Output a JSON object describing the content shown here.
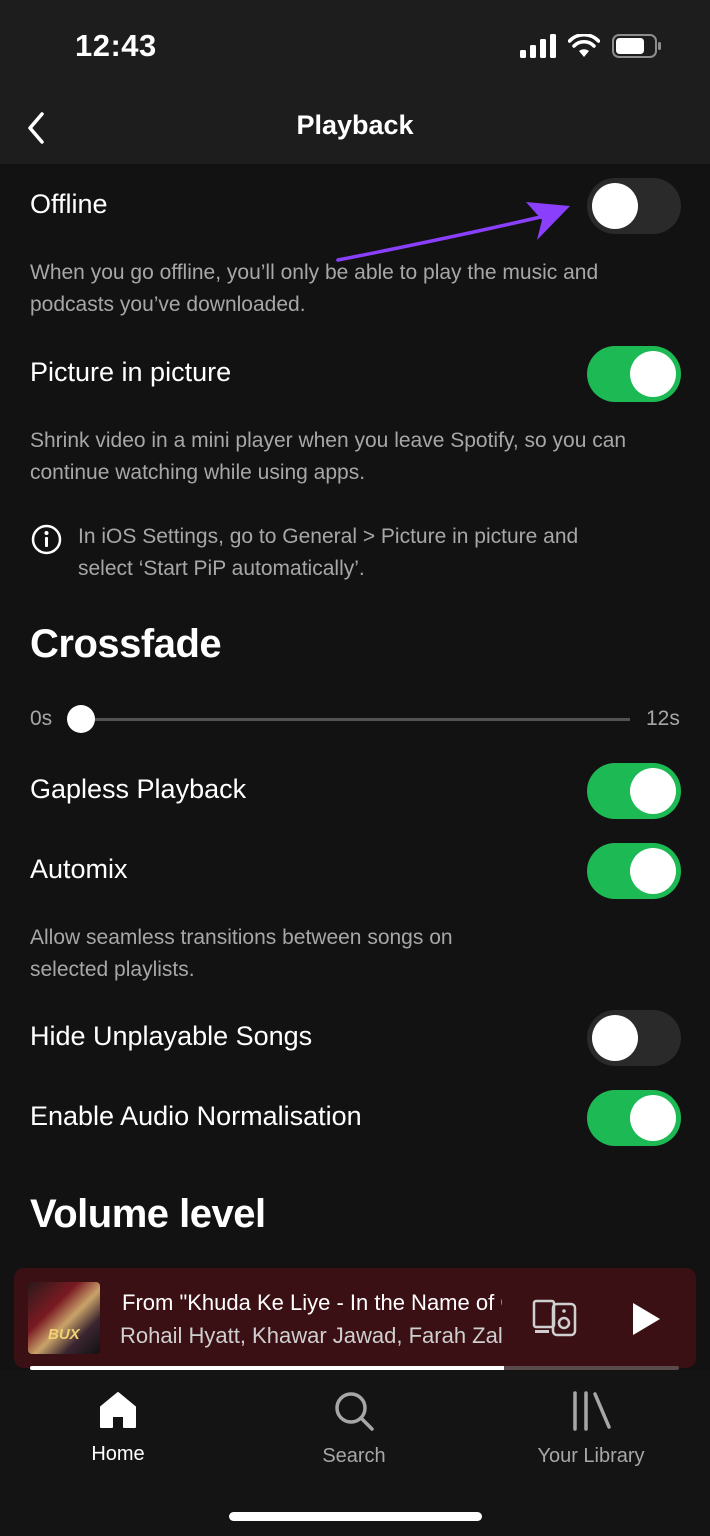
{
  "status_bar": {
    "time": "12:43"
  },
  "header": {
    "title": "Playback"
  },
  "settings": {
    "offline": {
      "label": "Offline",
      "enabled": false,
      "description": "When you go offline, you’ll only be able to play the music and podcasts you’ve downloaded."
    },
    "picture_in_picture": {
      "label": "Picture in picture",
      "enabled": true,
      "description": "Shrink video in a mini player when you leave Spotify, so you can continue watching while using apps.",
      "info": "In iOS Settings, go to General > Picture in picture and select ‘Start PiP automatically’."
    },
    "crossfade": {
      "heading": "Crossfade",
      "min_label": "0s",
      "max_label": "12s",
      "value_seconds": 0
    },
    "gapless_playback": {
      "label": "Gapless Playback",
      "enabled": true
    },
    "automix": {
      "label": "Automix",
      "enabled": true,
      "description": "Allow seamless transitions between songs on selected playlists."
    },
    "hide_unplayable": {
      "label": "Hide Unplayable Songs",
      "enabled": false
    },
    "audio_normalisation": {
      "label": "Enable Audio Normalisation",
      "enabled": true
    },
    "volume_level": {
      "heading": "Volume level"
    }
  },
  "mini_player": {
    "title": "From \"Khuda Ke Liye - In the Name of God\"",
    "artist": "Rohail Hyatt, Khawar Jawad, Farah Zala",
    "cover_text": "BUX",
    "progress": 0.73
  },
  "tabs": [
    {
      "label": "Home",
      "icon": "home-icon",
      "active": true
    },
    {
      "label": "Search",
      "icon": "search-icon",
      "active": false
    },
    {
      "label": "Your Library",
      "icon": "library-icon",
      "active": false
    }
  ],
  "colors": {
    "accent": "#1db954",
    "background": "#121212",
    "annotation_arrow": "#8a3ffc"
  }
}
